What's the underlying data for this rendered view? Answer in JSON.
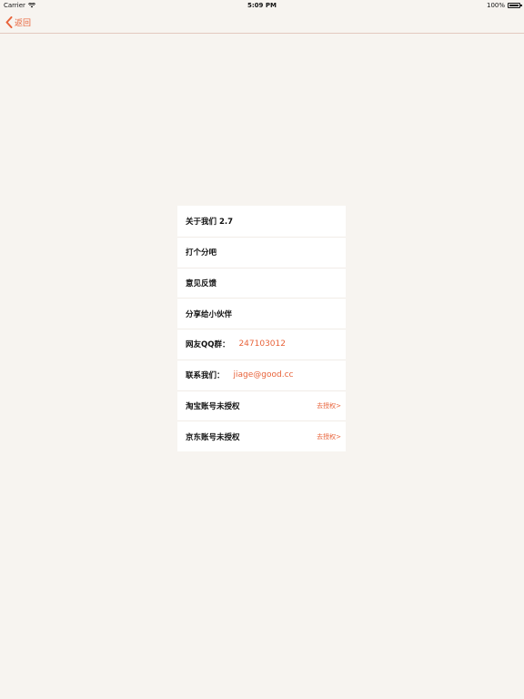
{
  "status_bar": {
    "carrier": "Carrier",
    "time": "5:09 PM",
    "battery": "100%"
  },
  "nav": {
    "back_label": "返回"
  },
  "menu": {
    "about": "关于我们 2.7",
    "rate": "打个分吧",
    "feedback": "意见反馈",
    "share": "分享给小伙伴",
    "qq_label": "网友QQ群：",
    "qq_value": "247103012",
    "contact_label": "联系我们：",
    "contact_value": "jiage@good.cc",
    "taobao_label": "淘宝账号未授权",
    "taobao_action": "去授权>",
    "jd_label": "京东账号未授权",
    "jd_action": "去授权>"
  },
  "colors": {
    "accent": "#e8633a",
    "background": "#f7f4f0",
    "panel": "#ffffff"
  }
}
